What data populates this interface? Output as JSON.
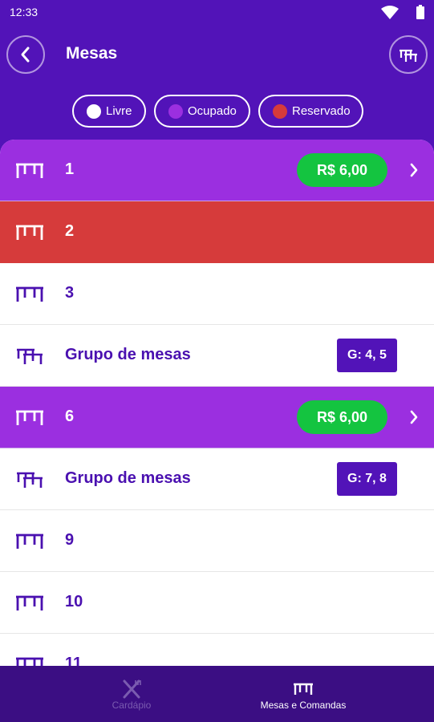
{
  "status_bar": {
    "time": "12:33"
  },
  "header": {
    "title": "Mesas"
  },
  "legend": [
    {
      "label": "Livre",
      "color": "#ffffff"
    },
    {
      "label": "Ocupado",
      "color": "#9b2fe0"
    },
    {
      "label": "Reservado",
      "color": "#d63b3b"
    }
  ],
  "tables": [
    {
      "label": "1",
      "status": "occupied",
      "amount": "R$ 6,00"
    },
    {
      "label": "2",
      "status": "reserved"
    },
    {
      "label": "3",
      "status": "free"
    },
    {
      "label": "Grupo de mesas",
      "status": "free",
      "group": "G: 4, 5"
    },
    {
      "label": "6",
      "status": "occupied",
      "amount": "R$ 6,00"
    },
    {
      "label": "Grupo de mesas",
      "status": "free",
      "group": "G: 7, 8"
    },
    {
      "label": "9",
      "status": "free"
    },
    {
      "label": "10",
      "status": "free"
    },
    {
      "label": "11",
      "status": "free"
    }
  ],
  "bottom_nav": [
    {
      "label": "Cardápio",
      "icon": "fork-knife-icon",
      "active": false
    },
    {
      "label": "Mesas e Comandas",
      "icon": "table-icon",
      "active": true
    }
  ],
  "colors": {
    "header": "#5213b8",
    "occupied": "#9b2fe0",
    "reserved": "#d63b3b",
    "free_text": "#4a10b0",
    "price_badge": "#14c440",
    "bottom_nav": "#3b0e83"
  }
}
